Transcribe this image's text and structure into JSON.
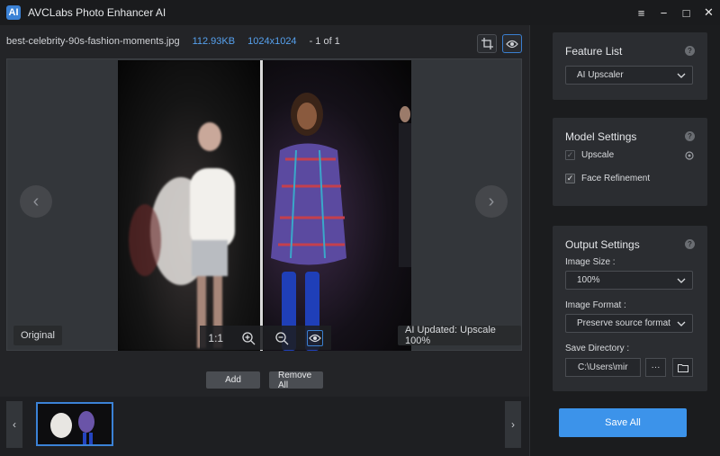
{
  "app": {
    "title": "AVCLabs Photo Enhancer AI",
    "logo_glyph": "AI"
  },
  "window_controls": {
    "menu": "≡",
    "minimize": "−",
    "maximize": "□",
    "close": "✕"
  },
  "file": {
    "name": "best-celebrity-90s-fashion-moments.jpg",
    "size": "112.93KB",
    "dimensions": "1024x1024",
    "count": "- 1 of 1"
  },
  "viewer": {
    "original_label": "Original",
    "updated_label": "AI Updated: Upscale 100%",
    "zoom_label": "1:1",
    "prev_arrow": "‹",
    "next_arrow": "›"
  },
  "actions": {
    "add": "Add",
    "remove_all": "Remove All"
  },
  "strip": {
    "prev": "‹",
    "next": "›"
  },
  "feature_list": {
    "title": "Feature List",
    "selected": "AI Upscaler"
  },
  "model_settings": {
    "title": "Model Settings",
    "upscale": "Upscale",
    "face_refinement": "Face Refinement",
    "check": "✓"
  },
  "output_settings": {
    "title": "Output Settings",
    "image_size_label": "Image Size :",
    "image_size": "100%",
    "image_format_label": "Image Format :",
    "image_format": "Preserve source format",
    "save_directory_label": "Save Directory :",
    "save_directory": "C:\\Users\\mir",
    "more": "···"
  },
  "help_glyph": "?",
  "save_all": "Save All",
  "colors": {
    "accent": "#3c93ea",
    "link": "#56a1ee",
    "panel": "#2b2d31"
  }
}
